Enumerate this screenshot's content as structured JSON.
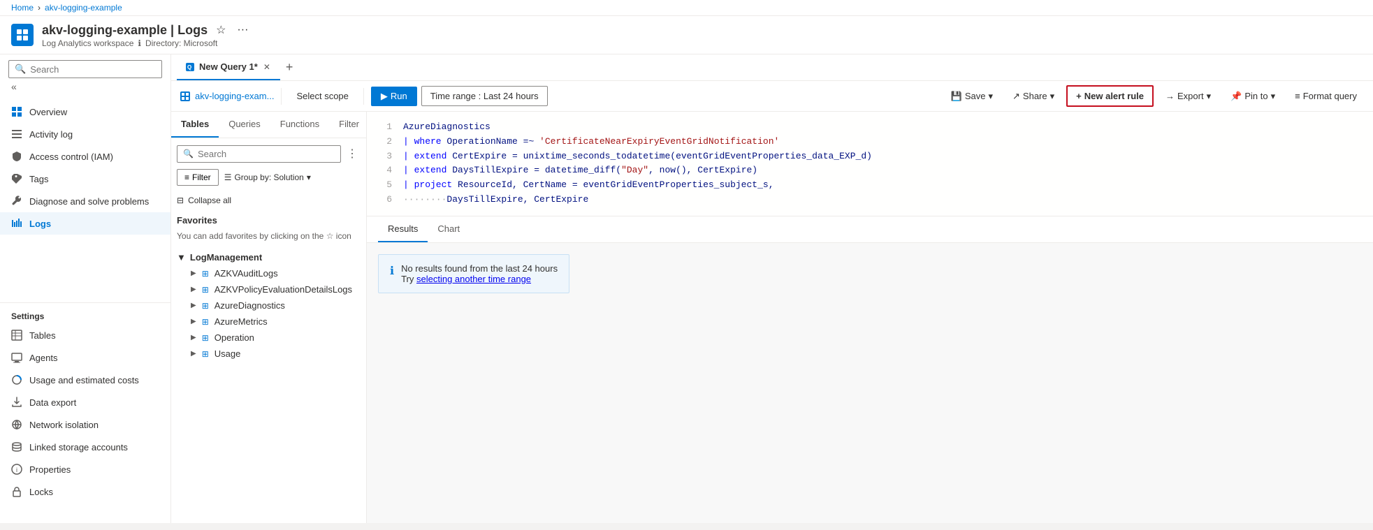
{
  "breadcrumb": {
    "home": "Home",
    "resource": "akv-logging-example"
  },
  "header": {
    "title": "akv-logging-example | Logs",
    "subtitle": "Log Analytics workspace",
    "directory": "Directory: Microsoft"
  },
  "sidebar": {
    "search_placeholder": "Search",
    "nav_items": [
      {
        "id": "overview",
        "label": "Overview",
        "icon": "grid"
      },
      {
        "id": "activity-log",
        "label": "Activity log",
        "icon": "list"
      },
      {
        "id": "access-control",
        "label": "Access control (IAM)",
        "icon": "shield"
      },
      {
        "id": "tags",
        "label": "Tags",
        "icon": "tag"
      },
      {
        "id": "diagnose",
        "label": "Diagnose and solve problems",
        "icon": "wrench"
      },
      {
        "id": "logs",
        "label": "Logs",
        "icon": "chart",
        "active": true
      }
    ],
    "settings_section": "Settings",
    "settings_items": [
      {
        "id": "tables",
        "label": "Tables",
        "icon": "table"
      },
      {
        "id": "agents",
        "label": "Agents",
        "icon": "computer"
      },
      {
        "id": "usage-costs",
        "label": "Usage and estimated costs",
        "icon": "circle"
      },
      {
        "id": "data-export",
        "label": "Data export",
        "icon": "export"
      },
      {
        "id": "network-isolation",
        "label": "Network isolation",
        "icon": "network"
      },
      {
        "id": "linked-storage",
        "label": "Linked storage accounts",
        "icon": "storage"
      },
      {
        "id": "properties",
        "label": "Properties",
        "icon": "info"
      },
      {
        "id": "locks",
        "label": "Locks",
        "icon": "lock"
      }
    ]
  },
  "tab_bar": {
    "tabs": [
      {
        "id": "query1",
        "label": "New Query 1*",
        "active": true
      }
    ],
    "add_label": "+"
  },
  "toolbar": {
    "scope": "akv-logging-exam...",
    "select_scope": "Select scope",
    "run_label": "Run",
    "time_range": "Time range : Last 24 hours",
    "save_label": "Save",
    "share_label": "Share",
    "new_alert_label": "New alert rule",
    "export_label": "Export",
    "pin_label": "Pin to",
    "format_label": "Format query"
  },
  "tables_panel": {
    "tabs": [
      "Tables",
      "Queries",
      "Functions",
      "Filter"
    ],
    "active_tab": "Tables",
    "search_placeholder": "Search",
    "filter_label": "Filter",
    "group_by_label": "Group by: Solution",
    "collapse_all": "Collapse all",
    "favorites": {
      "header": "Favorites",
      "hint": "You can add favorites by clicking on the ☆ icon"
    },
    "groups": [
      {
        "name": "LogManagement",
        "tables": [
          "AZKVAuditLogs",
          "AZKVPolicyEvaluationDetailsLogs",
          "AzureDiagnostics",
          "AzureMetrics",
          "Operation",
          "Usage"
        ]
      }
    ]
  },
  "editor": {
    "lines": [
      {
        "num": 1,
        "text": "AzureDiagnostics",
        "parts": [
          {
            "type": "plain",
            "val": "AzureDiagnostics"
          }
        ]
      },
      {
        "num": 2,
        "text": "| where OperationName =~ 'CertificateNearExpiryEventGridNotification'",
        "parts": [
          {
            "type": "kw",
            "val": "| where "
          },
          {
            "type": "plain",
            "val": "OperationName =~ "
          },
          {
            "type": "str",
            "val": "'CertificateNearExpiryEventGridNotification'"
          }
        ]
      },
      {
        "num": 3,
        "text": "| extend CertExpire = unixtime_seconds_todatetime(eventGridEventProperties_data_EXP_d)",
        "parts": [
          {
            "type": "kw",
            "val": "| extend "
          },
          {
            "type": "plain",
            "val": "CertExpire = unixtime_seconds_todatetime(eventGridEventProperties_data_EXP_d)"
          }
        ]
      },
      {
        "num": 4,
        "text": "| extend DaysTillExpire = datetime_diff(\"Day\", now(), CertExpire)",
        "parts": [
          {
            "type": "kw",
            "val": "| extend "
          },
          {
            "type": "plain",
            "val": "DaysTillExpire = datetime_diff("
          },
          {
            "type": "str",
            "val": "\"Day\""
          },
          {
            "type": "plain",
            "val": ", now(), CertExpire)"
          }
        ]
      },
      {
        "num": 5,
        "text": "| project ResourceId, CertName = eventGridEventProperties_subject_s,",
        "parts": [
          {
            "type": "kw",
            "val": "| project "
          },
          {
            "type": "plain",
            "val": "ResourceId, CertName = eventGridEventProperties_subject_s,"
          }
        ]
      },
      {
        "num": 6,
        "text": "        DaysTillExpire, CertExpire",
        "parts": [
          {
            "type": "plain",
            "val": "        DaysTillExpire, CertExpire"
          }
        ]
      }
    ]
  },
  "results": {
    "tabs": [
      "Results",
      "Chart"
    ],
    "active_tab": "Results",
    "no_results_message": "No results found from the last 24 hours",
    "no_results_link": "selecting another time range",
    "no_results_try": "Try "
  }
}
